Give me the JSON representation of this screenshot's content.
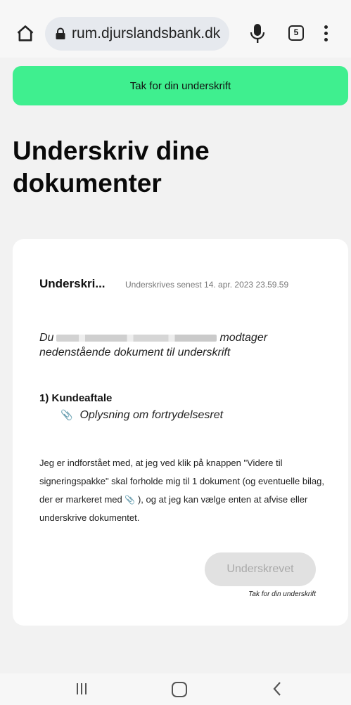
{
  "browser": {
    "url": "rum.djurslandsbank.dk",
    "tab_count": "5",
    "icons": [
      "home-icon",
      "lock-icon",
      "mic-icon",
      "tabs-icon",
      "more-vert-icon"
    ]
  },
  "banner": {
    "text": "Tak for din underskrift",
    "color": "#3fef8f"
  },
  "page": {
    "title": "Underskriv dine dokumenter"
  },
  "card": {
    "title": "Underskri...",
    "deadline": "Underskrives senest 14. apr. 2023 23.59.59",
    "recipient_prefix": "Du",
    "recipient_suffix": "modtager nedenstående dokument til underskrift",
    "document_title": "1) Kundeaftale",
    "attachment": "Oplysning om fortrydelsesret",
    "consent_part1": "Jeg er indforstået med, at jeg ved klik på knappen \"Videre til signeringspakke\" skal forholde mig til 1 dokument (og eventuelle bilag, der er markeret med",
    "consent_part2": "), og at jeg kan vælge enten at afvise eller underskrive dokumentet.",
    "button_label": "Underskrevet",
    "button_note": "Tak for din underskrift"
  },
  "navbar": {
    "icons": [
      "recents-icon",
      "home-nav-icon",
      "back-icon"
    ]
  }
}
